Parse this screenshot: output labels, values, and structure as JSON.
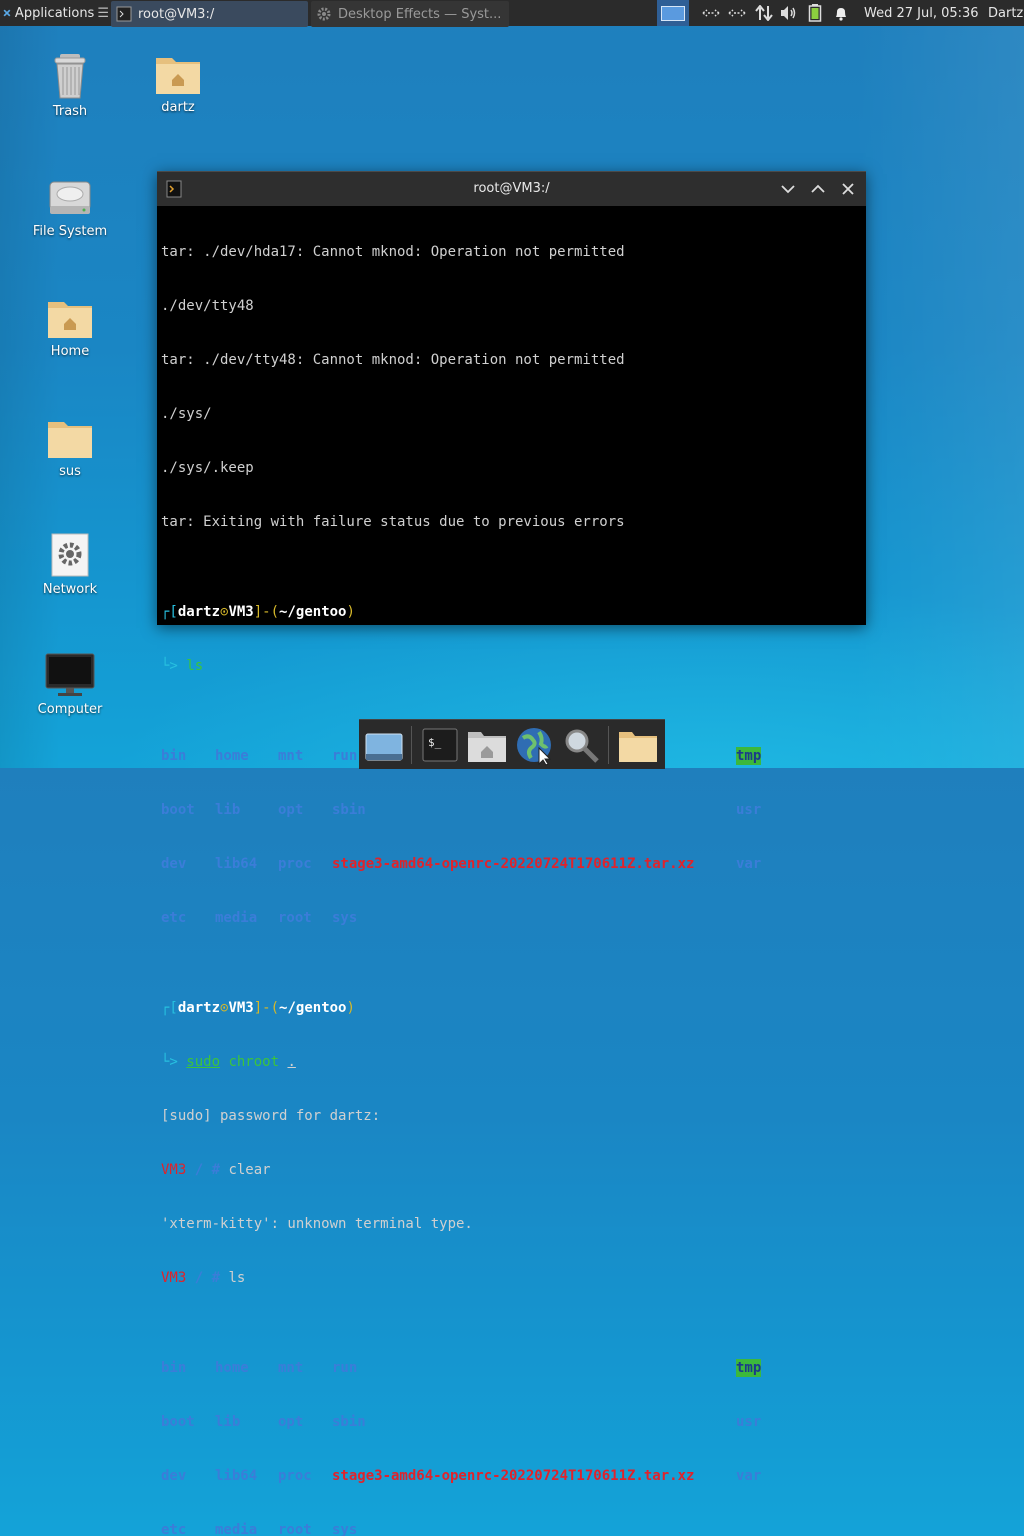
{
  "panel": {
    "applications_label": "Applications",
    "tasks": [
      {
        "label": "root@VM3:/"
      },
      {
        "label": "Desktop Effects  — Syst..."
      }
    ],
    "clock": "Wed 27 Jul, 05:36",
    "user": "Dartz",
    "tray_icons": [
      "network-wired-icon",
      "network-wired-icon",
      "network-transfer-icon",
      "volume-icon",
      "battery-icon",
      "notification-bell-icon"
    ]
  },
  "desktop": {
    "icons": [
      {
        "label": "Trash",
        "icon": "trash-icon"
      },
      {
        "label": "dartz",
        "icon": "home-folder-icon"
      },
      {
        "label": "File System",
        "icon": "drive-icon"
      },
      {
        "label": "Home",
        "icon": "home-folder-icon"
      },
      {
        "label": "sus",
        "icon": "folder-icon"
      },
      {
        "label": "Network",
        "icon": "network-settings-icon"
      },
      {
        "label": "Computer",
        "icon": "monitor-icon"
      }
    ]
  },
  "terminal": {
    "title": "root@VM3:/",
    "lines": {
      "l1": "tar: ./dev/hda17: Cannot mknod: Operation not permitted",
      "l2": "./dev/tty48",
      "l3": "tar: ./dev/tty48: Cannot mknod: Operation not permitted",
      "l4": "./sys/",
      "l5": "./sys/.keep",
      "l6": "tar: Exiting with failure status due to previous errors"
    },
    "prompt1": {
      "open": "┌[",
      "user": "dartz",
      "at": "⊙",
      "host": "VM3",
      "mid": "]-(",
      "path": "~/gentoo",
      "close": ")"
    },
    "prompt1_cmd_prefix": "└> ",
    "cmd_ls": "ls",
    "ls_rows": [
      [
        "bin",
        "home",
        "mnt",
        "run",
        "",
        "tmp"
      ],
      [
        "boot",
        "lib",
        "opt",
        "sbin",
        "",
        "usr"
      ],
      [
        "dev",
        "lib64",
        "proc",
        "",
        "stage3-amd64-openrc-20220724T170611Z.tar.xz",
        "var"
      ],
      [
        "etc",
        "media",
        "root",
        "sys",
        "",
        ""
      ]
    ],
    "cmd_sudo": "sudo",
    "cmd_chroot": "chroot",
    "cmd_dot": ".",
    "sudo_prompt": "[sudo] password for dartz:",
    "root_host": "VM3",
    "root_prompt_tail": " / # ",
    "cmd_clear": "clear",
    "clear_error": "'xterm-kitty': unknown terminal type.",
    "cmd_ls2": "ls"
  },
  "dock": {
    "items": [
      "show-desktop-icon",
      "terminal-icon",
      "home-folder-icon",
      "web-browser-icon",
      "search-icon",
      "folder-icon"
    ]
  }
}
